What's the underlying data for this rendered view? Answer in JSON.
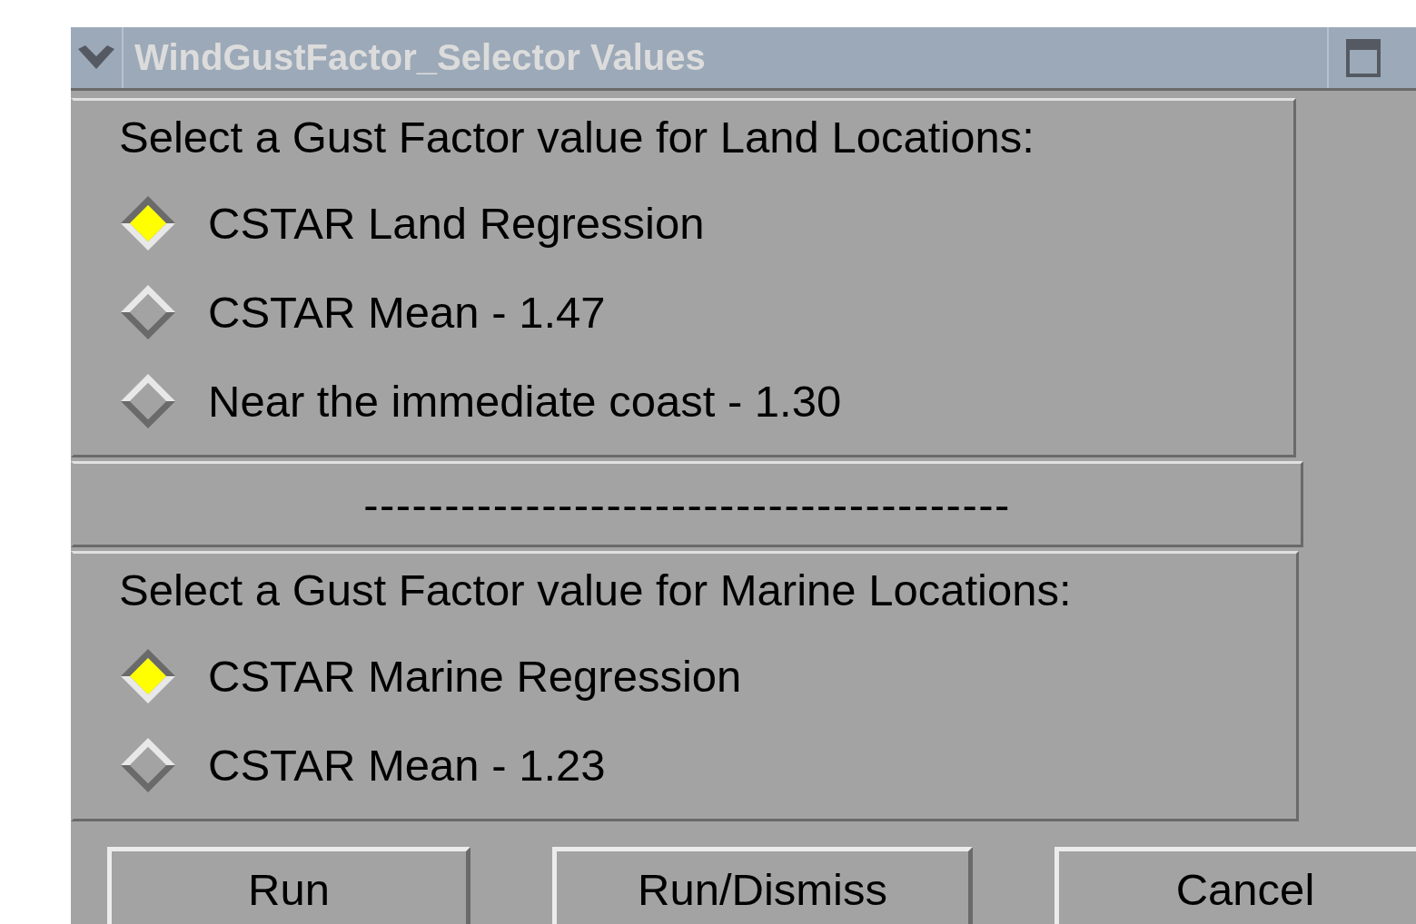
{
  "window": {
    "title": "WindGustFactor_Selector Values"
  },
  "sections": [
    {
      "kind": "radio_group",
      "prompt": "Select a Gust Factor value for Land Locations:",
      "options": [
        {
          "label": "CSTAR Land Regression",
          "selected": true
        },
        {
          "label": "CSTAR Mean - 1.47",
          "selected": false
        },
        {
          "label": "Near the immediate coast - 1.30",
          "selected": false
        }
      ]
    },
    {
      "kind": "separator",
      "text": "----------------------------------------"
    },
    {
      "kind": "radio_group",
      "prompt": "Select a Gust Factor value for Marine Locations:",
      "options": [
        {
          "label": "CSTAR Marine Regression",
          "selected": true
        },
        {
          "label": "CSTAR Mean - 1.23",
          "selected": false
        }
      ]
    }
  ],
  "buttons": [
    "Run",
    "Run/Dismiss",
    "Cancel"
  ]
}
